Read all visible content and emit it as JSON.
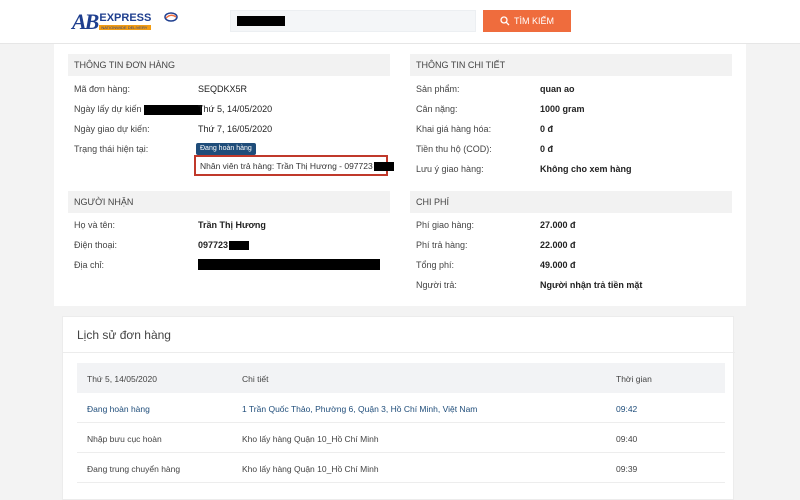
{
  "header": {
    "logo_main": "AB",
    "logo_sub": "EXPRESS",
    "logo_tagline": "NATIONWIDE DELIVERY",
    "search_button": "TÌM KIẾM"
  },
  "order_info": {
    "title": "THÔNG TIN ĐƠN HÀNG",
    "rows": [
      {
        "label": "Mã đơn hàng:",
        "value": "SEQDKX5R"
      },
      {
        "label": "Ngày lấy dự kiến",
        "value": "Thứ 5, 14/05/2020"
      },
      {
        "label": "Ngày giao dự kiến:",
        "value": "Thứ 7, 16/05/2020"
      },
      {
        "label": "Trạng thái hiện tại:",
        "value": ""
      }
    ],
    "status_badge": "Đang hoàn hàng",
    "returner_text": "Nhân viên trả hàng: Trần Thị Hương - 097723"
  },
  "detail_info": {
    "title": "THÔNG TIN CHI TIẾT",
    "rows": [
      {
        "label": "Sản phẩm:",
        "value": "quan ao"
      },
      {
        "label": "Cân nặng:",
        "value": "1000 gram"
      },
      {
        "label": "Khai giá hàng hóa:",
        "value": "0 đ"
      },
      {
        "label": "Tiền thu hộ (COD):",
        "value": "0 đ"
      },
      {
        "label": "Lưu ý giao hàng:",
        "value": "Không cho xem hàng"
      }
    ]
  },
  "receiver": {
    "title": "NGƯỜI NHẬN",
    "rows": [
      {
        "label": "Họ và tên:",
        "value": "Trần Thị Hương"
      },
      {
        "label": "Điện thoại:",
        "value": "097723"
      },
      {
        "label": "Địa chỉ:",
        "value": ""
      }
    ]
  },
  "cost": {
    "title": "CHI PHÍ",
    "rows": [
      {
        "label": "Phí giao hàng:",
        "value": "27.000 đ"
      },
      {
        "label": "Phí trả hàng:",
        "value": "22.000 đ"
      },
      {
        "label": "Tổng phí:",
        "value": "49.000 đ"
      },
      {
        "label": "Người trả:",
        "value": "Người nhận trả tiền mặt"
      }
    ]
  },
  "history": {
    "title": "Lịch sử đơn hàng",
    "columns": [
      "Thứ 5, 14/05/2020",
      "Chi tiết",
      "Thời gian"
    ],
    "rows": [
      {
        "status": "Đang hoàn hàng",
        "detail": "1 Trần Quốc Thảo, Phường 6, Quận 3, Hồ Chí Minh, Việt Nam",
        "time": "09:42"
      },
      {
        "status": "Nhập bưu cục hoàn",
        "detail": "Kho lấy hàng Quận 10_Hồ Chí Minh",
        "time": "09:40"
      },
      {
        "status": "Đang trung chuyển hàng",
        "detail": "Kho lấy hàng Quận 10_Hồ Chí Minh",
        "time": "09:39"
      }
    ]
  },
  "colors": {
    "accent": "#ef6c3d",
    "brand": "#1f3f8f",
    "link": "#1f4d7a",
    "highlight_border": "#c0392b"
  }
}
